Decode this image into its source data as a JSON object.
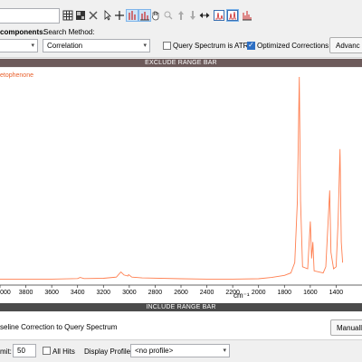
{
  "toolbar": {
    "icons": [
      "grid-icon",
      "dashboard-icon",
      "tools-icon",
      "pointer-icon",
      "crosshair-icon",
      "peak-pick-icon",
      "peak-label-icon",
      "pan-hand-icon",
      "zoom-icon",
      "expand-up-icon",
      "expand-down-icon",
      "swap-horizontal-icon",
      "spectrum-view-1-icon",
      "spectrum-view-2-icon",
      "spectrum-view-3-icon"
    ]
  },
  "params": {
    "components_label": "components:",
    "search_method_label": "Search Method:",
    "search_method_value": "Correlation",
    "atr_label": "Query Spectrum is ATR",
    "atr_checked": false,
    "optimized_label": "Optimized Corrections",
    "optimized_checked": true,
    "advanced_button": "Advanc"
  },
  "exclude_bar": "EXCLUDE RANGE BAR",
  "include_bar": "INCLUDE RANGE BAR",
  "chart_data": {
    "type": "line",
    "series": [
      {
        "name": "etophenone",
        "color": "#ff7f50"
      }
    ],
    "x_unit": "cm⁻¹",
    "xticks": [
      "4000",
      "3800",
      "3600",
      "3400",
      "3200",
      "3000",
      "2800",
      "2600",
      "2400",
      "2200",
      "2000",
      "1800",
      "1600",
      "1400"
    ],
    "x_reversed": true,
    "x_range_visible": [
      4000,
      1350
    ],
    "points": [
      [
        4000,
        2
      ],
      [
        3800,
        2
      ],
      [
        3600,
        2
      ],
      [
        3400,
        2.3
      ],
      [
        3380,
        2.8
      ],
      [
        3350,
        2.3
      ],
      [
        3200,
        2.4
      ],
      [
        3100,
        3
      ],
      [
        3065,
        5.5
      ],
      [
        3040,
        4
      ],
      [
        3010,
        3.5
      ],
      [
        3005,
        4.2
      ],
      [
        2980,
        3
      ],
      [
        2900,
        2.6
      ],
      [
        2600,
        2.2
      ],
      [
        2400,
        2.0
      ],
      [
        2200,
        2.0
      ],
      [
        2000,
        2.2
      ],
      [
        1900,
        2.8
      ],
      [
        1800,
        3.8
      ],
      [
        1750,
        5
      ],
      [
        1720,
        10
      ],
      [
        1700,
        40
      ],
      [
        1685,
        100
      ],
      [
        1675,
        40
      ],
      [
        1660,
        8
      ],
      [
        1620,
        7
      ],
      [
        1600,
        30
      ],
      [
        1590,
        12
      ],
      [
        1580,
        20
      ],
      [
        1570,
        6
      ],
      [
        1500,
        5
      ],
      [
        1480,
        8
      ],
      [
        1450,
        45
      ],
      [
        1440,
        15
      ],
      [
        1420,
        7
      ],
      [
        1400,
        8
      ],
      [
        1385,
        30
      ],
      [
        1370,
        65
      ],
      [
        1360,
        20
      ],
      [
        1350,
        10
      ]
    ],
    "y_range": [
      0,
      100
    ]
  },
  "bottom": {
    "baseline_label": "seline Correction to Query Spectrum",
    "manual_button": "Manuall",
    "limit_label": "mit:",
    "limit_value": "50",
    "all_hits_label": "All Hits",
    "all_hits_checked": false,
    "display_profiles_label": "Display Profiles:",
    "display_profiles_value": "<no profile>"
  }
}
